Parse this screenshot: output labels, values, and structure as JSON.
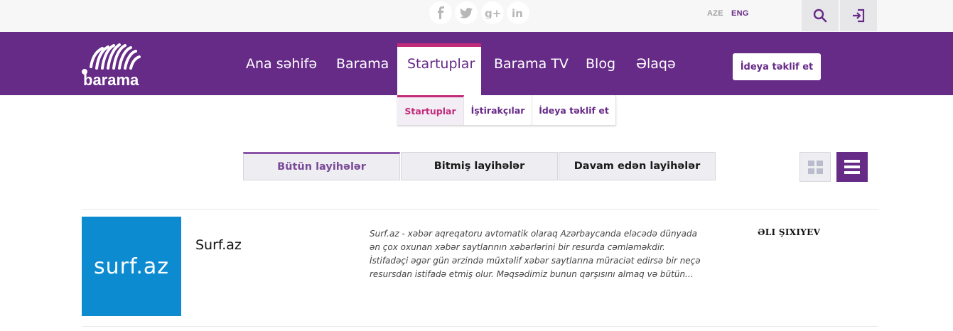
{
  "social": [
    {
      "name": "facebook",
      "glyph": "f"
    },
    {
      "name": "twitter",
      "glyph": "t"
    },
    {
      "name": "google-plus",
      "glyph": "g+"
    },
    {
      "name": "linkedin",
      "glyph": "in"
    }
  ],
  "languages": {
    "aze": "AZE",
    "eng": "ENG",
    "active": "ENG"
  },
  "brand": {
    "logo_text": "barama",
    "primary_color": "#662a87",
    "accent_color": "#c22b79"
  },
  "nav": {
    "items": [
      "Ana səhifə",
      "Barama",
      "Startuplar",
      "Barama TV",
      "Blog",
      "Əlaqə"
    ],
    "active": "Startuplar",
    "cta": "İdeya təklif et"
  },
  "subnav": {
    "items": [
      "Startuplar",
      "İştirakçılar",
      "İdeya təklif et"
    ],
    "active": "Startuplar"
  },
  "filters": {
    "tabs": [
      "Bütün layihələr",
      "Bitmiş layihələr",
      "Davam edən layihələr"
    ],
    "active": "Bütün layihələr"
  },
  "view_mode": {
    "options": [
      "grid",
      "list"
    ],
    "active": "list"
  },
  "projects": [
    {
      "thumb_text": "surf.az",
      "thumb_color": "#0d8bd1",
      "title": "Surf.az",
      "description": "Surf.az - xəbər aqreqatoru avtomatik olaraq Azərbaycanda eləcədə dünyada ən çox oxunan xəbər saytlarının xəbərlərini bir resurda cəmləməkdir. İstifadəçi əgər gün ərzində müxtəlif xəbər saytlarına müraciət edirsə bir neçə resursdan istifadə etmiş olur. Məqsədimiz bunun qarşısını almaq və bütün...",
      "author": "ƏLI ŞIXIYEV"
    }
  ]
}
